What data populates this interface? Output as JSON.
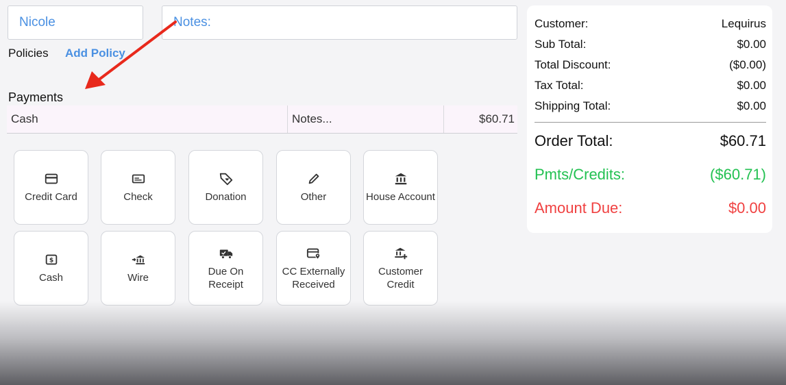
{
  "header": {
    "name_value": "Nicole",
    "notes_placeholder": "Notes:"
  },
  "policies": {
    "label": "Policies",
    "add_label": "Add Policy"
  },
  "payments": {
    "label": "Payments",
    "rows": [
      {
        "method": "Cash",
        "notes_placeholder": "Notes...",
        "amount": "$60.71"
      }
    ]
  },
  "tiles": [
    {
      "label": "Credit Card",
      "icon": "credit-card-icon"
    },
    {
      "label": "Check",
      "icon": "check-icon"
    },
    {
      "label": "Donation",
      "icon": "tag-heart-icon"
    },
    {
      "label": "Other",
      "icon": "pencil-icon"
    },
    {
      "label": "House Account",
      "icon": "bank-icon"
    },
    {
      "label": "Cash",
      "icon": "cash-icon"
    },
    {
      "label": "Wire",
      "icon": "wire-transfer-icon"
    },
    {
      "label": "Due On Receipt",
      "icon": "truck-icon"
    },
    {
      "label": "CC Externally Received",
      "icon": "card-location-icon"
    },
    {
      "label": "Customer Credit",
      "icon": "bank-plus-icon"
    }
  ],
  "summary": {
    "customer_label": "Customer:",
    "customer_value": "Lequirus",
    "subtotal_label": "Sub Total:",
    "subtotal_value": "$0.00",
    "discount_label": "Total Discount:",
    "discount_value": "($0.00)",
    "tax_label": "Tax Total:",
    "tax_value": "$0.00",
    "shipping_label": "Shipping Total:",
    "shipping_value": "$0.00",
    "order_total_label": "Order Total:",
    "order_total_value": "$60.71",
    "pmts_label": "Pmts/Credits:",
    "pmts_value": "($60.71)",
    "due_label": "Amount Due:",
    "due_value": "$0.00"
  },
  "colors": {
    "accent": "#4a90e2",
    "annotation_arrow": "#e8291c",
    "credit_green": "#23c152",
    "due_red": "#f04141"
  }
}
